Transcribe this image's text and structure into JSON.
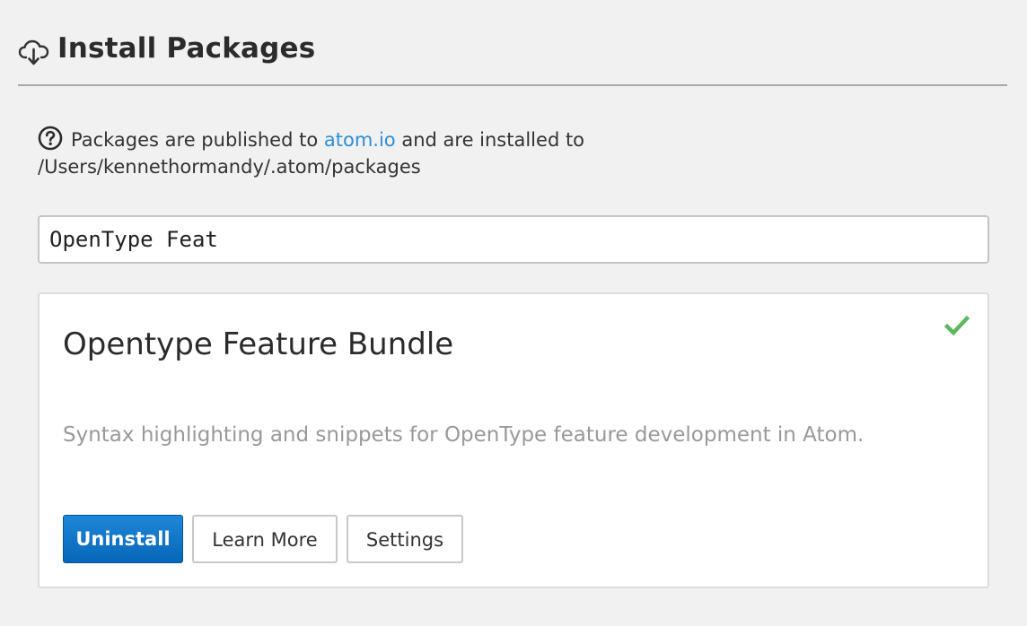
{
  "header": {
    "title": "Install Packages",
    "icon": "cloud-download-icon"
  },
  "info": {
    "icon": "question-circle-icon",
    "text_before": "Packages are published to",
    "link": "atom.io",
    "text_after": "and are installed to",
    "path": "/Users/kennethormandy/.atom/packages"
  },
  "search": {
    "value": "OpenType Feat",
    "placeholder": ""
  },
  "package": {
    "name": "Opentype Feature Bundle",
    "description": "Syntax highlighting and snippets for OpenType feature development in Atom.",
    "installed_icon": "checkmark-icon",
    "buttons": {
      "uninstall": "Uninstall",
      "learn_more": "Learn More",
      "settings": "Settings"
    }
  },
  "colors": {
    "accent": "#2d8ed8",
    "primary_button": "#0f76c8",
    "installed_check": "#5cb85c",
    "description_text": "#999999"
  }
}
